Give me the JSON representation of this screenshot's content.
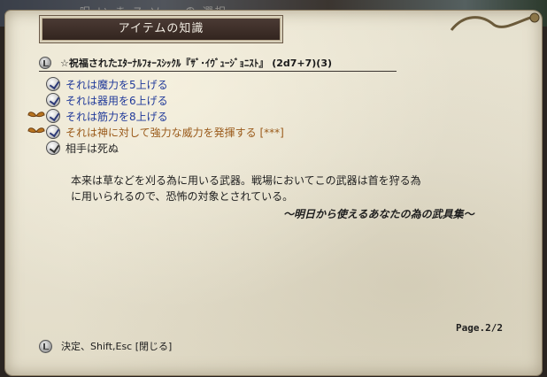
{
  "window": {
    "background_text": "呪 い ま ス ソ … の 選択",
    "title": "アイテムの知識",
    "item_name": "☆祝福されたｴﾀｰﾅﾙﾌｫｰｽｼｯｸﾙ『ｻﾞ･ｲｳﾞｭｰｼﾞｮﾆｽﾄ』 (2d7+7)(3)",
    "properties": [
      {
        "text": "それは魔力を5上げる",
        "color": "blue",
        "decor": false,
        "icon": "magic-icon"
      },
      {
        "text": "それは器用を6上げる",
        "color": "blue",
        "decor": false,
        "icon": "dexterity-icon"
      },
      {
        "text": "それは筋力を8上げる",
        "color": "blue",
        "decor": true,
        "icon": "strength-icon"
      },
      {
        "text": "それは神に対して強力な威力を発揮する [***]",
        "color": "orange",
        "decor": true,
        "icon": "god-slaying-icon"
      },
      {
        "text": "相手は死ぬ",
        "color": "dark",
        "decor": false,
        "icon": "death-icon"
      }
    ],
    "description": [
      "本来は草などを刈る為に用いる武器。戦場においてこの武器は首を狩る為",
      "に用いられるので、恐怖の対象とされている。"
    ],
    "quote": "～明日から使えるあなたの為の武具集～",
    "page": "Page.2/2",
    "footer_hint": "決定、Shift,Esc [閉じる]"
  },
  "colors": {
    "blue": "#213a9a",
    "orange": "#9a5a1a",
    "dark": "#2a2a2a"
  }
}
